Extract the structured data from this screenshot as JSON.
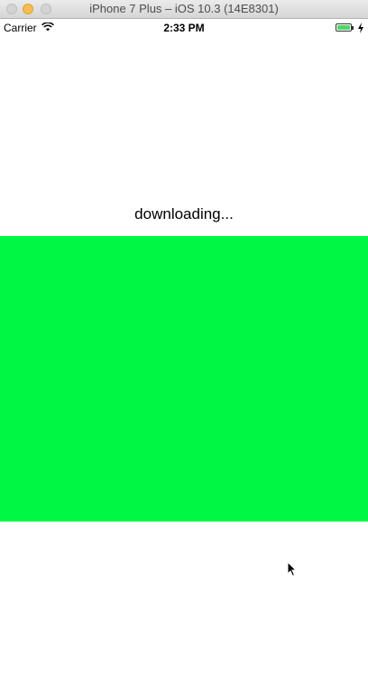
{
  "window": {
    "title": "iPhone 7 Plus – iOS 10.3 (14E8301)"
  },
  "status_bar": {
    "carrier": "Carrier",
    "time": "2:33 PM",
    "wifi_icon": "wifi-icon",
    "battery_icon": "battery-icon",
    "charging_icon": "charging-bolt-icon"
  },
  "content": {
    "status_text": "downloading...",
    "view_color": "#00F844"
  },
  "colors": {
    "green_view": "#00F844",
    "battery_fill": "#4cd964"
  }
}
